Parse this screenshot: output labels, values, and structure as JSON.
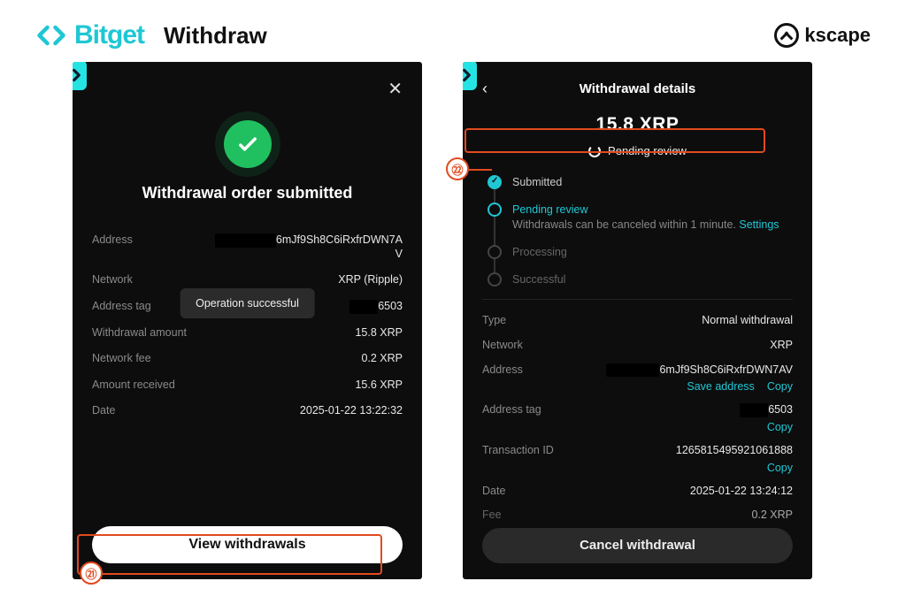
{
  "header": {
    "brand": "Bitget",
    "page_title": "Withdraw",
    "kscape": "kscape"
  },
  "step_labels": {
    "s21": "㉑",
    "s22": "㉒"
  },
  "screen1": {
    "heading": "Withdrawal order submitted",
    "toast": "Operation successful",
    "rows": {
      "address_label": "Address",
      "address_value_suffix": "6mJf9Sh8C6iRxfrDWN7AV",
      "network_label": "Network",
      "network_value": "XRP (Ripple)",
      "tag_label": "Address tag",
      "tag_value": "6503",
      "amount_label": "Withdrawal amount",
      "amount_value": "15.8 XRP",
      "fee_label": "Network fee",
      "fee_value": "0.2 XRP",
      "received_label": "Amount received",
      "received_value": "15.6 XRP",
      "date_label": "Date",
      "date_value": "2025-01-22 13:22:32"
    },
    "view_button": "View withdrawals"
  },
  "screen2": {
    "title": "Withdrawal details",
    "amount": "15.8 XRP",
    "pending_label": "Pending review",
    "timeline": {
      "submitted": "Submitted",
      "pending": "Pending review",
      "pending_note_prefix": "Withdrawals can be canceled within 1 minute. ",
      "pending_note_link": "Settings",
      "processing": "Processing",
      "successful": "Successful"
    },
    "rows": {
      "type_label": "Type",
      "type_value": "Normal withdrawal",
      "network_label": "Network",
      "network_value": "XRP",
      "address_label": "Address",
      "address_value_suffix": "6mJf9Sh8C6iRxfrDWN7AV",
      "save_address": "Save address",
      "copy": "Copy",
      "tag_label": "Address tag",
      "tag_value": "6503",
      "txid_label": "Transaction ID",
      "txid_value": "1265815495921061888",
      "date_label": "Date",
      "date_value": "2025-01-22 13:24:12",
      "fee_label": "Fee",
      "fee_value": "0.2 XRP"
    },
    "cancel_button": "Cancel withdrawal"
  }
}
